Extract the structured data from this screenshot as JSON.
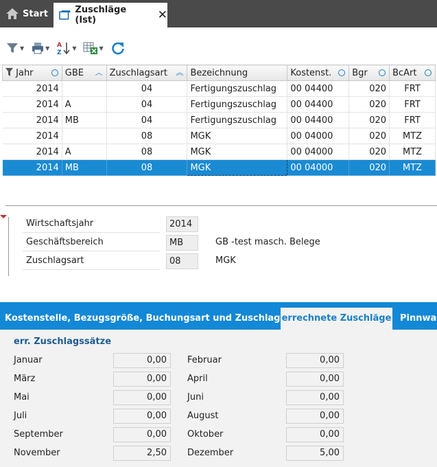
{
  "topbar": {
    "start_label": "Start",
    "active_tab_label": "Zuschläge (Ist)"
  },
  "grid": {
    "columns": [
      "Jahr",
      "GBE",
      "Zuschlagsart",
      "Bezeichnung",
      "Kostenst.",
      "Bgr",
      "BcArt"
    ],
    "rows": [
      [
        "2014",
        "",
        "04",
        "Fertigungszuschlag",
        "00 04400",
        "020",
        "FRT"
      ],
      [
        "2014",
        "A",
        "04",
        "Fertigungszuschlag",
        "00 04400",
        "020",
        "FRT"
      ],
      [
        "2014",
        "MB",
        "04",
        "Fertigungszuschlag",
        "00 04400",
        "020",
        "FRT"
      ],
      [
        "2014",
        "",
        "08",
        "MGK",
        "00 04000",
        "020",
        "MTZ"
      ],
      [
        "2014",
        "A",
        "08",
        "MGK",
        "00 04000",
        "020",
        "MTZ"
      ],
      [
        "2014",
        "MB",
        "08",
        "MGK",
        "00 04000",
        "020",
        "MTZ"
      ]
    ]
  },
  "detail": {
    "year_label": "Wirtschaftsjahr",
    "year_value": "2014",
    "area_label": "Geschäftsbereich",
    "area_value": "MB",
    "area_text": "GB -test masch. Belege",
    "type_label": "Zuschlagsart",
    "type_value": "08",
    "type_text": "MGK"
  },
  "tabs": {
    "tab1": "Kostenstelle, Bezugsgröße, Buchungsart und Zuschlagsätze",
    "tab2": "errechnete Zuschläge",
    "tab3": "Pinnwan"
  },
  "rates": {
    "heading": "err. Zuschlagssätze",
    "months": [
      {
        "label": "Januar",
        "value": "0,00"
      },
      {
        "label": "Februar",
        "value": "0,00"
      },
      {
        "label": "März",
        "value": "0,00"
      },
      {
        "label": "April",
        "value": "0,00"
      },
      {
        "label": "Mai",
        "value": "0,00"
      },
      {
        "label": "Juni",
        "value": "0,00"
      },
      {
        "label": "Juli",
        "value": "0,00"
      },
      {
        "label": "August",
        "value": "0,00"
      },
      {
        "label": "September",
        "value": "0,00"
      },
      {
        "label": "Oktober",
        "value": "0,00"
      },
      {
        "label": "November",
        "value": "2,50"
      },
      {
        "label": "Dezember",
        "value": "5,00"
      }
    ]
  }
}
